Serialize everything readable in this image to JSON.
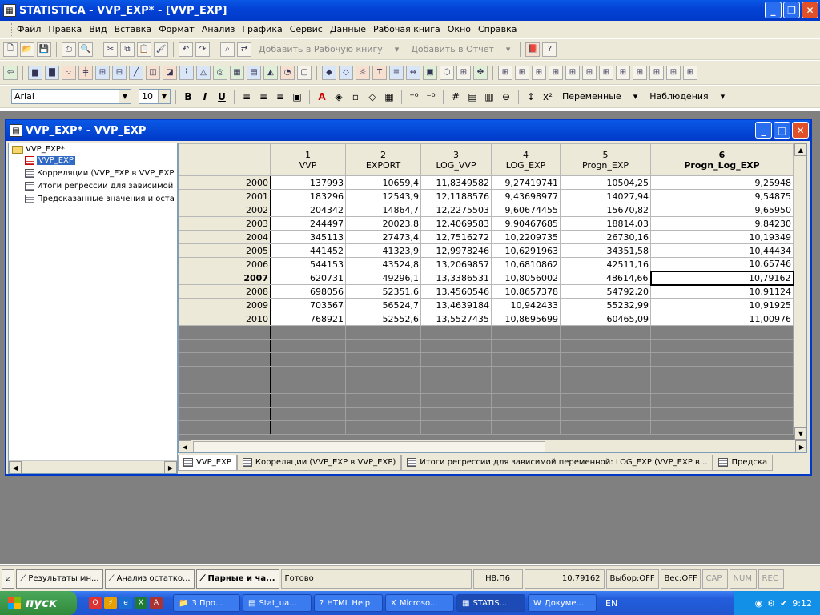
{
  "app": {
    "title": "STATISTICA - VVP_EXP* - [VVP_EXP]",
    "app_icon": "statistica-icon"
  },
  "menu": [
    "Файл",
    "Правка",
    "Вид",
    "Вставка",
    "Формат",
    "Анализ",
    "Графика",
    "Сервис",
    "Данные",
    "Рабочая книга",
    "Окно",
    "Справка"
  ],
  "toolbar1": {
    "add_workbook": "Добавить в Рабочую книгу",
    "add_report": "Добавить в Отчет"
  },
  "toolbar3": {
    "font": "Arial",
    "size": "10",
    "vars": "Переменные",
    "cases": "Наблюдения"
  },
  "child": {
    "title": "VVP_EXP* - VVP_EXP"
  },
  "tree": {
    "root": "VVP_EXP*",
    "items": [
      "VVP_EXP",
      "Корреляции (VVP_EXP в VVP_EXP",
      "Итоги регрессии для зависимой",
      "Предсказанные значения и оста"
    ]
  },
  "grid": {
    "columns": [
      {
        "num": "1",
        "name": "VVP"
      },
      {
        "num": "2",
        "name": "EXPORT"
      },
      {
        "num": "3",
        "name": "LOG_VVP"
      },
      {
        "num": "4",
        "name": "LOG_EXP"
      },
      {
        "num": "5",
        "name": "Progn_EXP"
      },
      {
        "num": "6",
        "name": "Progn_Log_EXP"
      }
    ],
    "rows": [
      {
        "label": "2000",
        "bold": false,
        "values": [
          "137993",
          "10659,4",
          "11,8349582",
          "9,27419741",
          "10504,25",
          "9,25948"
        ]
      },
      {
        "label": "2001",
        "bold": false,
        "values": [
          "183296",
          "12543,9",
          "12,1188576",
          "9,43698977",
          "14027,94",
          "9,54875"
        ]
      },
      {
        "label": "2002",
        "bold": false,
        "values": [
          "204342",
          "14864,7",
          "12,2275503",
          "9,60674455",
          "15670,82",
          "9,65950"
        ]
      },
      {
        "label": "2003",
        "bold": false,
        "values": [
          "244497",
          "20023,8",
          "12,4069583",
          "9,90467685",
          "18814,03",
          "9,84230"
        ]
      },
      {
        "label": "2004",
        "bold": false,
        "values": [
          "345113",
          "27473,4",
          "12,7516272",
          "10,2209735",
          "26730,16",
          "10,19349"
        ]
      },
      {
        "label": "2005",
        "bold": false,
        "values": [
          "441452",
          "41323,9",
          "12,9978246",
          "10,6291963",
          "34351,58",
          "10,44434"
        ]
      },
      {
        "label": "2006",
        "bold": false,
        "values": [
          "544153",
          "43524,8",
          "13,2069857",
          "10,6810862",
          "42511,16",
          "10,65746"
        ]
      },
      {
        "label": "2007",
        "bold": true,
        "values": [
          "620731",
          "49296,1",
          "13,3386531",
          "10,8056002",
          "48614,66",
          "10,79162"
        ]
      },
      {
        "label": "2008",
        "bold": false,
        "values": [
          "698056",
          "52351,6",
          "13,4560546",
          "10,8657378",
          "54792,20",
          "10,91124"
        ]
      },
      {
        "label": "2009",
        "bold": false,
        "values": [
          "703567",
          "56524,7",
          "13,4639184",
          "10,942433",
          "55232,99",
          "10,91925"
        ]
      },
      {
        "label": "2010",
        "bold": false,
        "values": [
          "768921",
          "52552,6",
          "13,5527435",
          "10,8695699",
          "60465,09",
          "11,00976"
        ]
      }
    ]
  },
  "tabs": [
    "VVP_EXP",
    "Корреляции (VVP_EXP в VVP_EXP)",
    "Итоги регрессии для зависимой переменной: LOG_EXP (VVP_EXP в...",
    "Предска"
  ],
  "status": {
    "tasks": [
      "Результаты мн...",
      "Анализ остатко...",
      "Парные и ча..."
    ],
    "ready": "Готово",
    "cell": "H8,П6",
    "value": "10,79162",
    "selection": "Выбор:OFF",
    "weight": "Вес:OFF",
    "cap": "CAP",
    "num": "NUM",
    "rec": "REC"
  },
  "taskbar": {
    "start": "пуск",
    "buttons": [
      "3 Про...",
      "Stat_ua...",
      "HTML Help",
      "Microso...",
      "STATIS...",
      "Докуме..."
    ],
    "lang": "EN",
    "time": "9:12"
  }
}
